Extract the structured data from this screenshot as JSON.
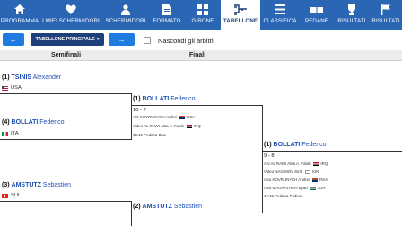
{
  "nav": {
    "items": [
      {
        "label": "PROGRAMMA",
        "icon": "home-icon"
      },
      {
        "label": "I MIEI SCHERMIDORI",
        "icon": "heart-icon"
      },
      {
        "label": "SCHERMIDORI",
        "icon": "fencer-icon"
      },
      {
        "label": "FORMATO",
        "icon": "document-icon"
      },
      {
        "label": "GIRONE",
        "icon": "grid-icon"
      },
      {
        "label": "TABELLONE",
        "icon": "bracket-icon"
      },
      {
        "label": "CLASSIFICA",
        "icon": "list-icon"
      },
      {
        "label": "PEDANE",
        "icon": "piste-icon"
      },
      {
        "label": "RISULTATI",
        "icon": "trophy-icon"
      },
      {
        "label": "RISULTATI",
        "icon": "flag-icon"
      }
    ],
    "active_index": 5,
    "accent": "#2a66b3"
  },
  "toolbar": {
    "prev_icon": "arrow-left-icon",
    "dropdown_label": "TABELLONE PRINCIPALE",
    "dropdown_icon": "chevron-down-icon",
    "next_icon": "arrow-right-icon",
    "hide_refs_label": "Nascondi gli arbitri",
    "hide_refs_checked": false
  },
  "columns": {
    "semifinals": "Semifinali",
    "finals": "Finali"
  },
  "bracket": {
    "sf1_top": {
      "seed": "(1)",
      "surname": "TSINIS",
      "given": "Alexander",
      "country": "USA"
    },
    "sf1_bottom": {
      "seed": "(4)",
      "surname": "BOLLATI",
      "given": "Federico",
      "country": "ITA"
    },
    "sf2_top": {
      "seed": "(3)",
      "surname": "AMSTUTZ",
      "given": "Sebastien",
      "country": "SUI"
    },
    "final_top": {
      "seed": "(1)",
      "surname": "BOLLATI",
      "given": "Federico",
      "score": "10 - 7",
      "ref1": "Arti KOVRUNYKH Andrei",
      "ref1_country": "RSA",
      "ref2": "Video AL RAWI Alaa A. Falah",
      "ref2_country": "IRQ",
      "location": "15:10 Pedana Blue"
    },
    "final_bottom": {
      "seed": "(2)",
      "surname": "AMSTUTZ",
      "given": "Sebastien"
    },
    "winner": {
      "seed": "(1)",
      "surname": "BOLLATI",
      "given": "Federico",
      "score": "9 - 8",
      "ref1": "Arti AL RAWI Alaa A. Falah",
      "ref1_country": "IRQ",
      "ref2": "Video NAGIMOV Ibraf",
      "ref2_country": "KIN",
      "ref3": "Assi KOVRUNYKH Andrei",
      "ref3_country": "RSA",
      "ref4": "Assi MAGHAYREH Eyad",
      "ref4_country": "JOR",
      "location": "17:45 Pedana Podium"
    }
  }
}
